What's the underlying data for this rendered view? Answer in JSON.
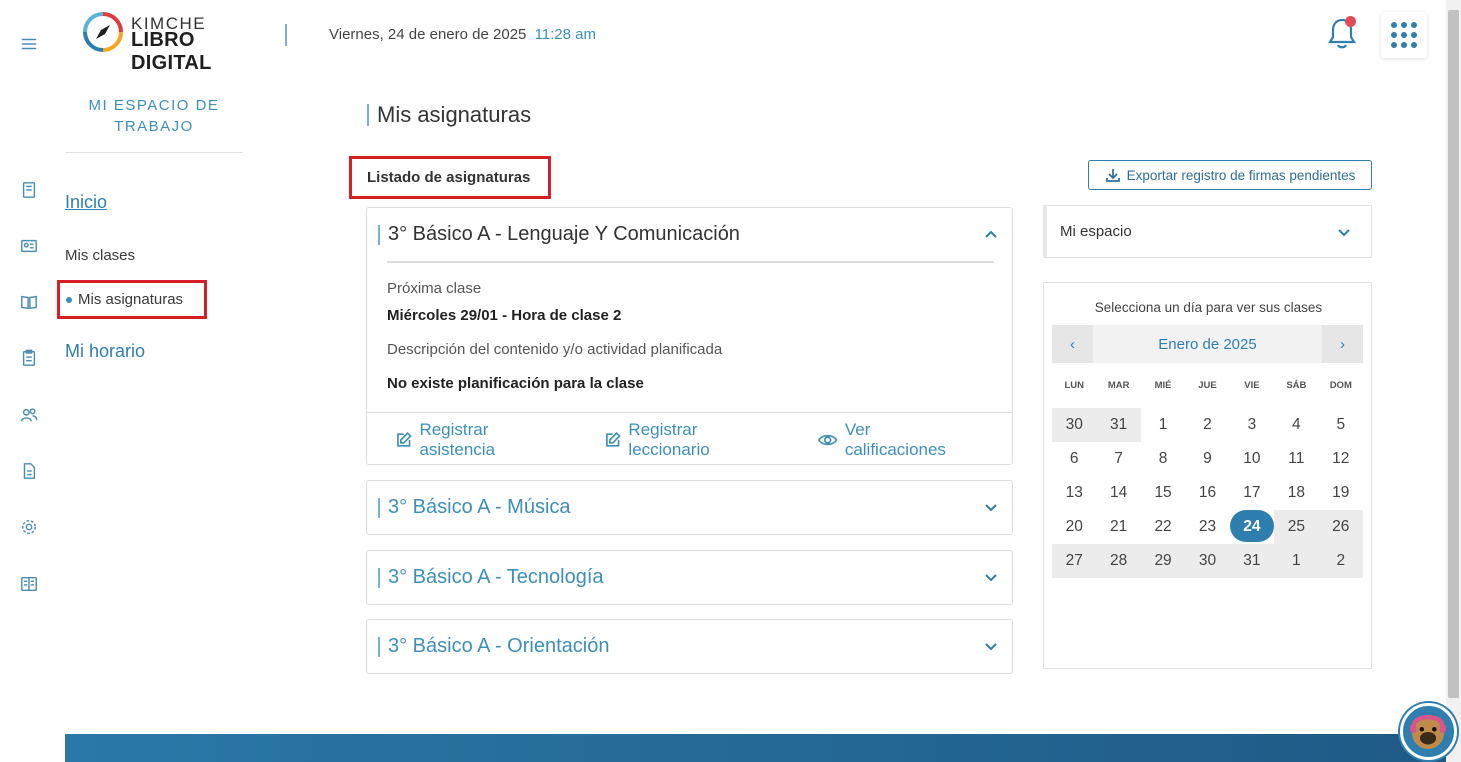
{
  "header": {
    "brand_top": "KIMCHE",
    "brand_bottom": "LIBRO DIGITAL",
    "date": "Viernes, 24 de enero de 2025",
    "time": "11:28 am"
  },
  "rail": {
    "icons": [
      "menu-icon",
      "notebook-icon",
      "id-card-icon",
      "book-open-icon",
      "clipboard-icon",
      "users-icon",
      "document-icon",
      "gear-icon",
      "book-icon"
    ]
  },
  "sidenav": {
    "title": "MI ESPACIO DE TRABAJO",
    "inicio": "Inicio",
    "mis_clases": "Mis clases",
    "mis_asignaturas": "Mis asignaturas",
    "mi_horario": "Mi horario"
  },
  "main": {
    "page_title": "Mis asignaturas",
    "list_title": "Listado de asignaturas",
    "cards": [
      {
        "title": "3° Básico A - Lenguaje Y Comunicación",
        "expanded": true,
        "next_class_label": "Próxima clase",
        "next_class_value": "Miércoles 29/01 - Hora de clase 2",
        "desc_label": "Descripción del contenido y/o actividad planificada",
        "desc_value": "No existe planificación para la clase",
        "actions": [
          "Registrar asistencia",
          "Registrar leccionario",
          "Ver calificaciones"
        ]
      },
      {
        "title": "3° Básico A - Música",
        "expanded": false
      },
      {
        "title": "3° Básico A - Tecnología",
        "expanded": false
      },
      {
        "title": "3° Básico A - Orientación",
        "expanded": false
      }
    ]
  },
  "right": {
    "export_label": "Exportar registro de firmas pendientes",
    "select_value": "Mi espacio",
    "calendar": {
      "caption": "Selecciona un día para ver sus clases",
      "prev": "‹",
      "next": "›",
      "month": "Enero de 2025",
      "weekdays": [
        "LUN",
        "MAR",
        "MIÉ",
        "JUE",
        "VIE",
        "SÁB",
        "DOM"
      ],
      "selected_day": "24",
      "days": [
        {
          "d": "30",
          "shade": true
        },
        {
          "d": "31",
          "shade": true
        },
        {
          "d": "1"
        },
        {
          "d": "2"
        },
        {
          "d": "3"
        },
        {
          "d": "4"
        },
        {
          "d": "5"
        },
        {
          "d": "6"
        },
        {
          "d": "7"
        },
        {
          "d": "8"
        },
        {
          "d": "9"
        },
        {
          "d": "10"
        },
        {
          "d": "11"
        },
        {
          "d": "12"
        },
        {
          "d": "13"
        },
        {
          "d": "14"
        },
        {
          "d": "15"
        },
        {
          "d": "16"
        },
        {
          "d": "17"
        },
        {
          "d": "18"
        },
        {
          "d": "19"
        },
        {
          "d": "20"
        },
        {
          "d": "21"
        },
        {
          "d": "22"
        },
        {
          "d": "23"
        },
        {
          "d": "24",
          "sel": true
        },
        {
          "d": "25",
          "shade": true
        },
        {
          "d": "26",
          "shade": true
        },
        {
          "d": "27",
          "shade": true
        },
        {
          "d": "28",
          "shade": true
        },
        {
          "d": "29",
          "shade": true
        },
        {
          "d": "30",
          "shade": true
        },
        {
          "d": "31",
          "shade": true
        },
        {
          "d": "1",
          "shade": true
        },
        {
          "d": "2",
          "shade": true
        }
      ]
    }
  },
  "colors": {
    "accent": "#2e7fb0",
    "highlight_box": "#d62027",
    "notification_dot": "#e14b57"
  }
}
